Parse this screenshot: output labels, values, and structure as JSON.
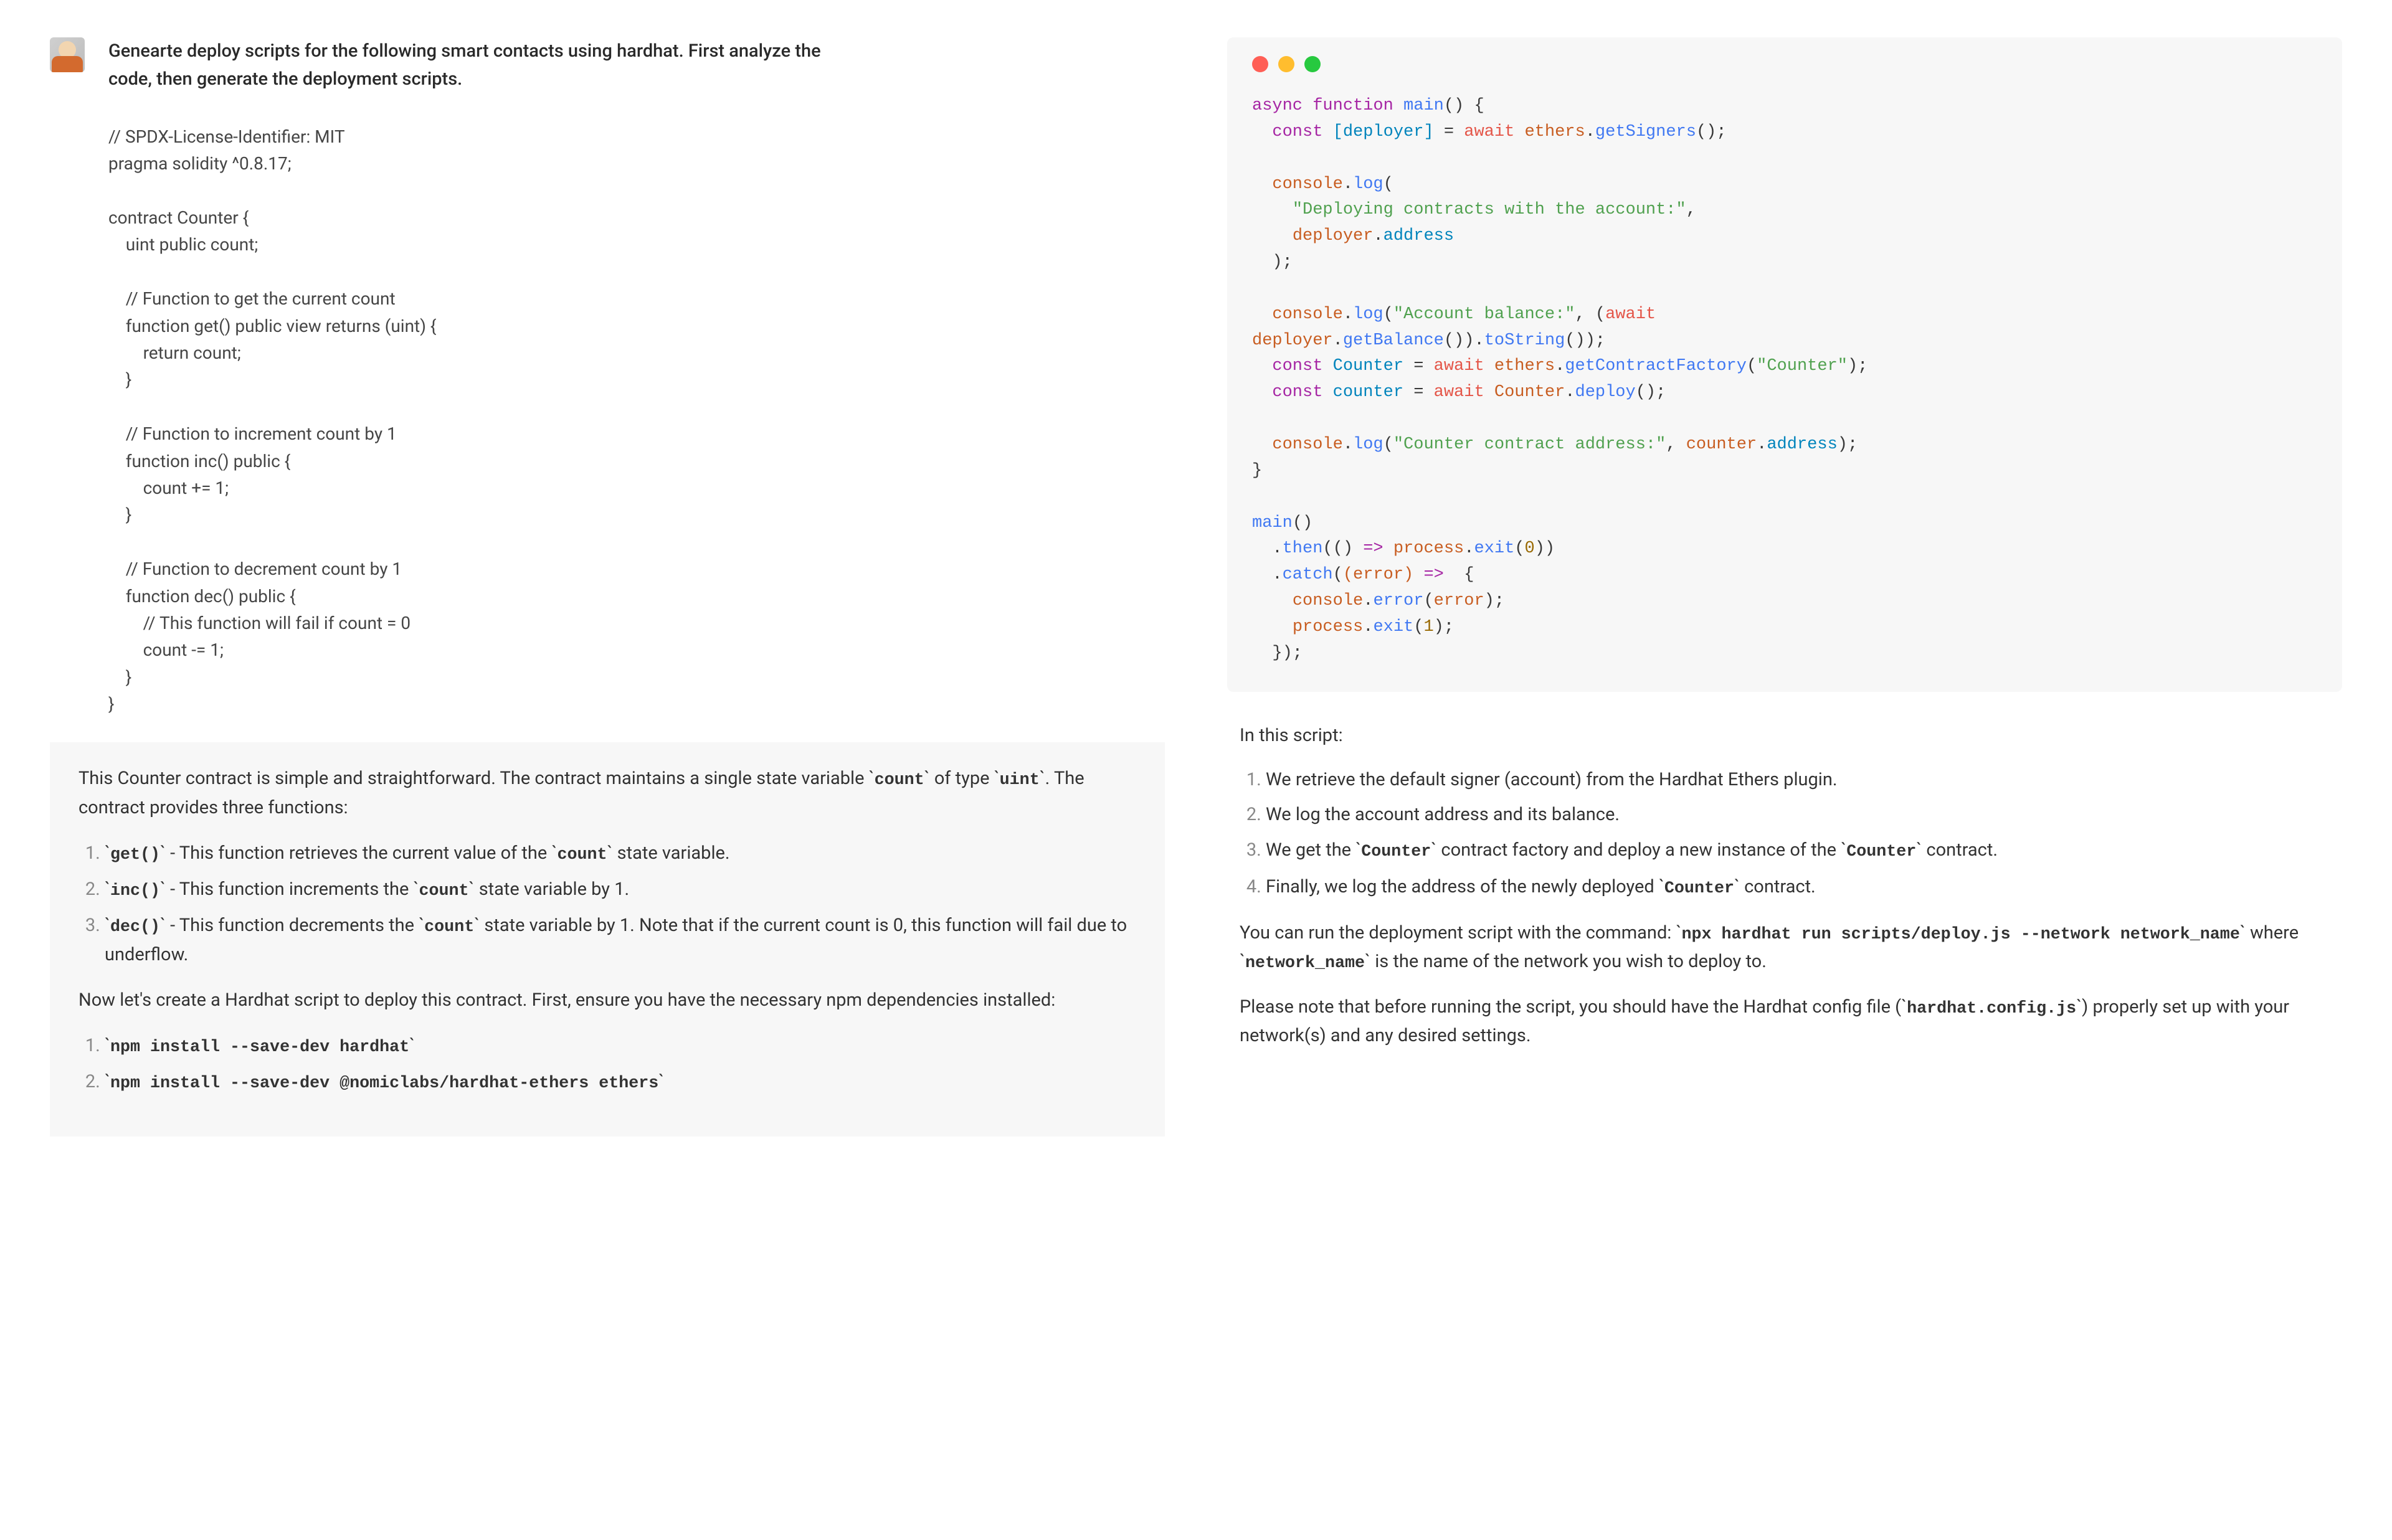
{
  "user": {
    "prompt_line1": "Genearte deploy scripts for the following smart contacts using hardhat. First analyze the",
    "prompt_line2": "code, then generate the deployment scripts."
  },
  "solidity": {
    "l01": "// SPDX-License-Identifier: MIT",
    "l02": "pragma solidity ^0.8.17;",
    "l03": "",
    "l04": "contract Counter {",
    "l05": "    uint public count;",
    "l06": "",
    "l07": "    // Function to get the current count",
    "l08": "    function get() public view returns (uint) {",
    "l09": "        return count;",
    "l10": "    }",
    "l11": "",
    "l12": "    // Function to increment count by 1",
    "l13": "    function inc() public {",
    "l14": "        count += 1;",
    "l15": "    }",
    "l16": "",
    "l17": "    // Function to decrement count by 1",
    "l18": "    function dec() public {",
    "l19": "        // This function will fail if count = 0",
    "l20": "        count -= 1;",
    "l21": "    }",
    "l22": "}"
  },
  "answer": {
    "intro_a": "This Counter contract is simple and straightforward. The contract maintains a single state",
    "intro_b1": "variable ",
    "intro_code_count": "count",
    "intro_b2": " of type ",
    "intro_code_uint": "uint",
    "intro_b3": ". The contract provides three functions:",
    "li1_code": "get()",
    "li1_text": " - This function retrieves the current value of the ",
    "li1_code2": "count",
    "li1_tail": " state variable.",
    "li2_code": "inc()",
    "li2_text": " - This function increments the ",
    "li2_code2": "count",
    "li2_tail": " state variable by 1.",
    "li3_code": "dec()",
    "li3_text": " - This function decrements the ",
    "li3_code2": "count",
    "li3_tail": " state variable by 1. Note that if the current count is 0, this function will fail due to underflow.",
    "now": "Now let's create a Hardhat script to deploy this contract. First, ensure you have the necessary npm dependencies installed:",
    "npm1": "npm install --save-dev hardhat",
    "npm2": "npm install --save-dev @nomiclabs/hardhat-ethers ethers"
  },
  "script": {
    "t": {
      "async": "async ",
      "function": "function ",
      "main": "main",
      "lp": "() {",
      "const": "const ",
      "deployer_br": "[deployer]",
      "eq": " = ",
      "await": "await ",
      "ethers": "ethers",
      "dot": ".",
      "getSigners": "getSigners",
      "callend": "();",
      "console": "console",
      "log": "log",
      "open": "(",
      "close": ")",
      "semi": ";",
      "comma": ",",
      "str_deploying": "\"Deploying contracts with the account:\"",
      "deployer": "deployer",
      "address": "address",
      "str_balance": "\"Account balance:\"",
      "getBalance": "getBalance",
      "toString": "toString",
      "Counter": "Counter",
      "getContractFactory": "getContractFactory",
      "str_Counter": "\"Counter\"",
      "counter": "counter",
      "deploy": "deploy",
      "str_addr": "\"Counter contract address:\"",
      "rb": "}",
      "then": "then",
      "arrow": " => ",
      "process": "process",
      "exit": "exit",
      "zero": "0",
      "one": "1",
      "catch": "catch",
      "error_param": "(error)",
      "error_ident": "error",
      "error_call": "error",
      "cb_open": " {",
      "cb_close": "});"
    }
  },
  "explain": {
    "heading": "In this script:",
    "e1": "We retrieve the default signer (account) from the Hardhat Ethers plugin.",
    "e2": "We log the account address and its balance.",
    "e3a": "We get the ",
    "e3code": "Counter",
    "e3b": " contract factory and deploy a new instance of the ",
    "e3code2": "Counter",
    "e3c": " contract.",
    "e4a": "Finally, we log the address of the newly deployed ",
    "e4code": "Counter",
    "e4b": " contract.",
    "run_a": "You can run the deployment script with the command: ",
    "run_code": "npx hardhat run scripts/deploy.js --network network_name",
    "run_b": " where ",
    "run_code2": "network_name",
    "run_c": " is the name of the network you wish to deploy to.",
    "note_a": "Please note that before running the script, you should have the Hardhat config file (",
    "note_code": "hardhat.config.js",
    "note_b": ") properly set up with your network(s) and any desired settings."
  }
}
